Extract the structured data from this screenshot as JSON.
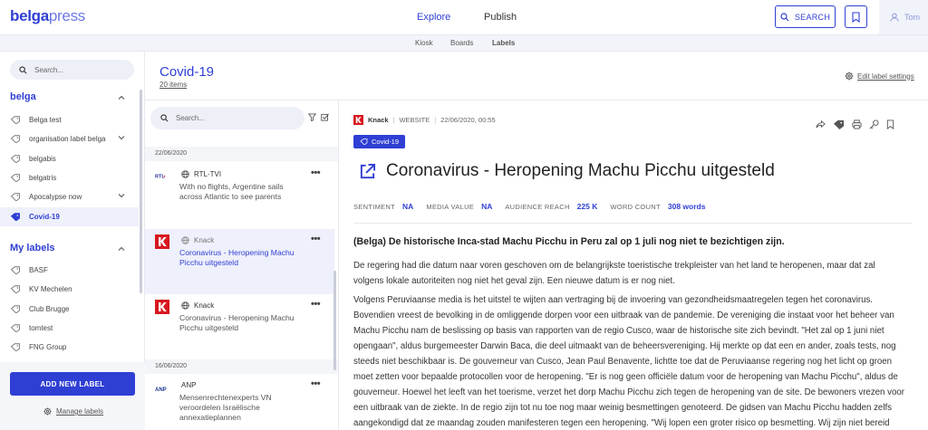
{
  "app": {
    "logo_bold": "belga",
    "logo_light": "press",
    "nav": {
      "explore": "Explore",
      "publish": "Publish"
    },
    "search_label": "SEARCH",
    "user": "Tom"
  },
  "subnav": {
    "kiosk": "Kiosk",
    "boards": "Boards",
    "labels": "Labels"
  },
  "sidebar": {
    "search_placeholder": "Search...",
    "group1_title": "belga",
    "group1_items": [
      {
        "label": "Belga test"
      },
      {
        "label": "organisation label belga"
      },
      {
        "label": "belgabis"
      },
      {
        "label": "belgatris"
      },
      {
        "label": "Apocalypse now"
      },
      {
        "label": "Covid-19"
      }
    ],
    "group2_title": "My labels",
    "group2_items": [
      {
        "label": "BASF"
      },
      {
        "label": "KV Mechelen"
      },
      {
        "label": "Club Brugge"
      },
      {
        "label": "tomtest"
      },
      {
        "label": "FNG Group"
      }
    ],
    "add_label": "ADD NEW LABEL",
    "manage_labels": "Manage labels"
  },
  "label": {
    "title": "Covid-19",
    "count": "20 items",
    "edit_settings": "Edit label settings"
  },
  "list": {
    "search_placeholder": "Search...",
    "dates": [
      "22/06/2020",
      "16/06/2020"
    ],
    "items": [
      {
        "source": "RTL-TVI",
        "title": "With no flights, Argentine sails across Atlantic to see parents"
      },
      {
        "source": "Knack",
        "title": "Coronavirus - Heropening Machu Picchu uitgesteld"
      },
      {
        "source": "Knack",
        "title": "Coronavirus - Heropening Machu Picchu uitgesteld"
      },
      {
        "source": "ANP",
        "title": "Mensenrechtenexperts VN veroordelen Israëlische annexatieplannen"
      }
    ],
    "more": "•••"
  },
  "article": {
    "source": "Knack",
    "type": "WEBSITE",
    "datetime": "22/06/2020, 00:55",
    "tag": "Covid-19",
    "title": "Coronavirus - Heropening Machu Picchu uitgesteld",
    "stats": {
      "sentiment_label": "SENTIMENT",
      "sentiment": "NA",
      "media_label": "MEDIA VALUE",
      "media": "NA",
      "reach_label": "AUDIENCE REACH",
      "reach": "225 K",
      "words_label": "WORD COUNT",
      "words": "308 words"
    },
    "lead": "(Belga) De historische Inca-stad Machu Picchu in Peru zal op 1 juli nog niet te bezichtigen zijn.",
    "para1": "De regering had die datum naar voren geschoven om de belangrijkste toeristische trekpleister van het land te heropenen, maar dat zal volgens lokale autoriteiten nog niet het geval zijn. Een nieuwe datum is er nog niet.",
    "para2": "Volgens Peruviaanse media is het uitstel te wijten aan vertraging bij de invoering van gezondheidsmaatregelen tegen het coronavirus. Bovendien vreest de bevolking in de omliggende dorpen voor een uitbraak van de pandemie. De vereniging die instaat voor het beheer van Machu Picchu nam de beslissing op basis van rapporten van de regio Cusco, waar de historische site zich bevindt. \"Het zal op 1 juni niet opengaan\", aldus burgemeester Darwin Baca, die deel uitmaakt van de beheersvereniging. Hij merkte op dat een en ander, zoals tests, nog steeds niet beschikbaar is. De gouverneur van Cusco, Jean Paul Benavente, lichtte toe dat de Peruviaanse regering nog het licht op groen moet zetten voor bepaalde protocollen voor de heropening. \"Er is nog geen officiële datum voor de heropening van Machu Picchu\", aldus de gouverneur. Hoewel het leeft van het toerisme, verzet het dorp Machu Picchu zich tegen de heropening van de site. De bewoners vrezen voor een uitbraak van de ziekte. In de regio zijn tot nu toe nog maar weinig besmettingen genoteerd. De gidsen van Machu Picchu hadden zelfs aangekondigd dat ze maandag zouden manifesteren tegen een heropening. \"Wij lopen een groter risico op besmetting. Wij zijn niet bereid bezoekers te"
  },
  "colors": {
    "accent": "#2f3fd4",
    "knack_red": "#d7171f"
  }
}
